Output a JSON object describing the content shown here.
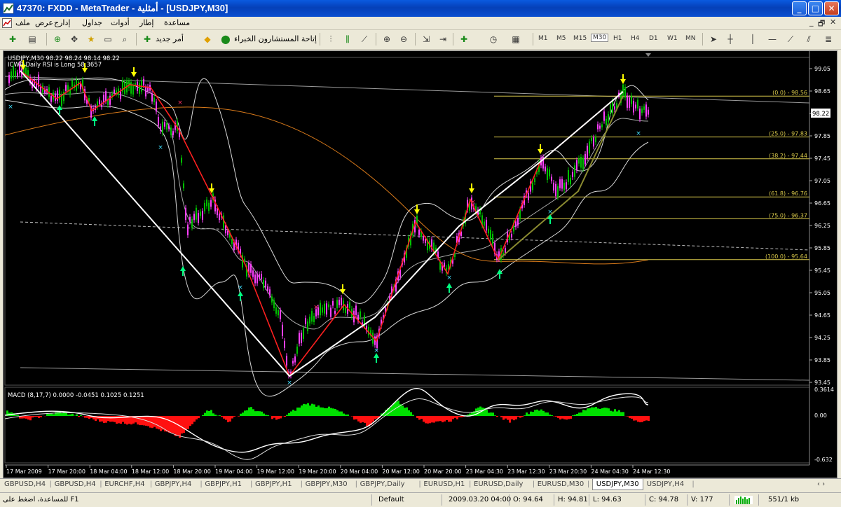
{
  "window": {
    "title": "47370: FXDD - MetaTrader - أمثلية - [USDJPY,M30]",
    "minimize": "_",
    "maximize": "□",
    "close": "✕"
  },
  "menu": {
    "items": [
      "ملف",
      "عرض",
      "إدارج",
      "جداول",
      "أدوات",
      "إطار",
      "مساعدة"
    ],
    "mdi_min": "_",
    "mdi_restore": "🗗",
    "mdi_close": "✕"
  },
  "toolbar": {
    "new_order": "أمر جديد",
    "experts": "إتاحة المستشارون الخبراء",
    "timeframes": [
      "M1",
      "M5",
      "M15",
      "M30",
      "H1",
      "H4",
      "D1",
      "W1",
      "MN"
    ],
    "active_timeframe": "M30"
  },
  "chart": {
    "symbol_info": "USDJPY,M30  98.22 98.24 98.14 98.22",
    "indicator_text": "ICWR-Daily RSI is Long 58.3657",
    "current_price": "98.22",
    "price_scale": [
      "99.05",
      "98.65",
      "98.25",
      "97.85",
      "97.45",
      "97.05",
      "96.65",
      "96.25",
      "95.85",
      "95.45",
      "95.05",
      "94.65",
      "94.25",
      "93.85",
      "93.45"
    ],
    "fib_levels": [
      {
        "label": "(0.0) - 98.56",
        "price": 98.56
      },
      {
        "label": "(25.0) - 97.83",
        "price": 97.83
      },
      {
        "label": "(38.2) - 97.44",
        "price": 97.44
      },
      {
        "label": "(61.8) - 96.76",
        "price": 96.76
      },
      {
        "label": "(75.0) - 96.37",
        "price": 96.37
      },
      {
        "label": "(100.0) - 95.64",
        "price": 95.64
      }
    ],
    "macd_label": "MACD  (8,17,7) 0.0000 -0.0451 0.1025 0.1251",
    "macd_scale": [
      "0.3614",
      "0.00",
      "-0.632"
    ],
    "time_labels": [
      "17 Mar 2009",
      "17 Mar 20:00",
      "18 Mar 04:00",
      "18 Mar 12:00",
      "18 Mar 20:00",
      "19 Mar 04:00",
      "19 Mar 12:00",
      "19 Mar 20:00",
      "20 Mar 04:00",
      "20 Mar 12:00",
      "20 Mar 20:00",
      "23 Mar 04:30",
      "23 Mar 12:30",
      "23 Mar 20:30",
      "24 Mar 04:30",
      "24 Mar 12:30"
    ]
  },
  "tabs": {
    "items": [
      "GBPUSD,H4",
      "GBPUSD,H4",
      "EURCHF,H4",
      "GBPJPY,H4",
      "GBPJPY,H1",
      "GBPJPY,H1",
      "GBPJPY,M30",
      "GBPJPY,Daily",
      "EURUSD,H1",
      "EURUSD,Daily",
      "EURUSD,M30",
      "USDJPY,M30",
      "USDJPY,H4"
    ],
    "active": "USDJPY,M30",
    "scroll": "‹  ›"
  },
  "status": {
    "help": "للمساعدة، اضغط على F1",
    "profile": "Default",
    "datetime": "2009.03.20 04:00",
    "open": "O: 94.64",
    "high": "H: 94.81",
    "low": "L: 94.63",
    "close": "C: 94.78",
    "volume": "V: 177",
    "traffic": "551/1 kb"
  },
  "colors": {
    "chart_bg": "#000000",
    "candle_body": "#ff40ff",
    "candle_green": "#00c000",
    "zigzag_red": "#ff2020",
    "zigzag_white": "#ffffff",
    "fib": "#d8c84a",
    "macd_pos": "#00e000",
    "macd_neg": "#ff1010",
    "arrow_up": "#00ff80",
    "arrow_down": "#ffff00"
  }
}
